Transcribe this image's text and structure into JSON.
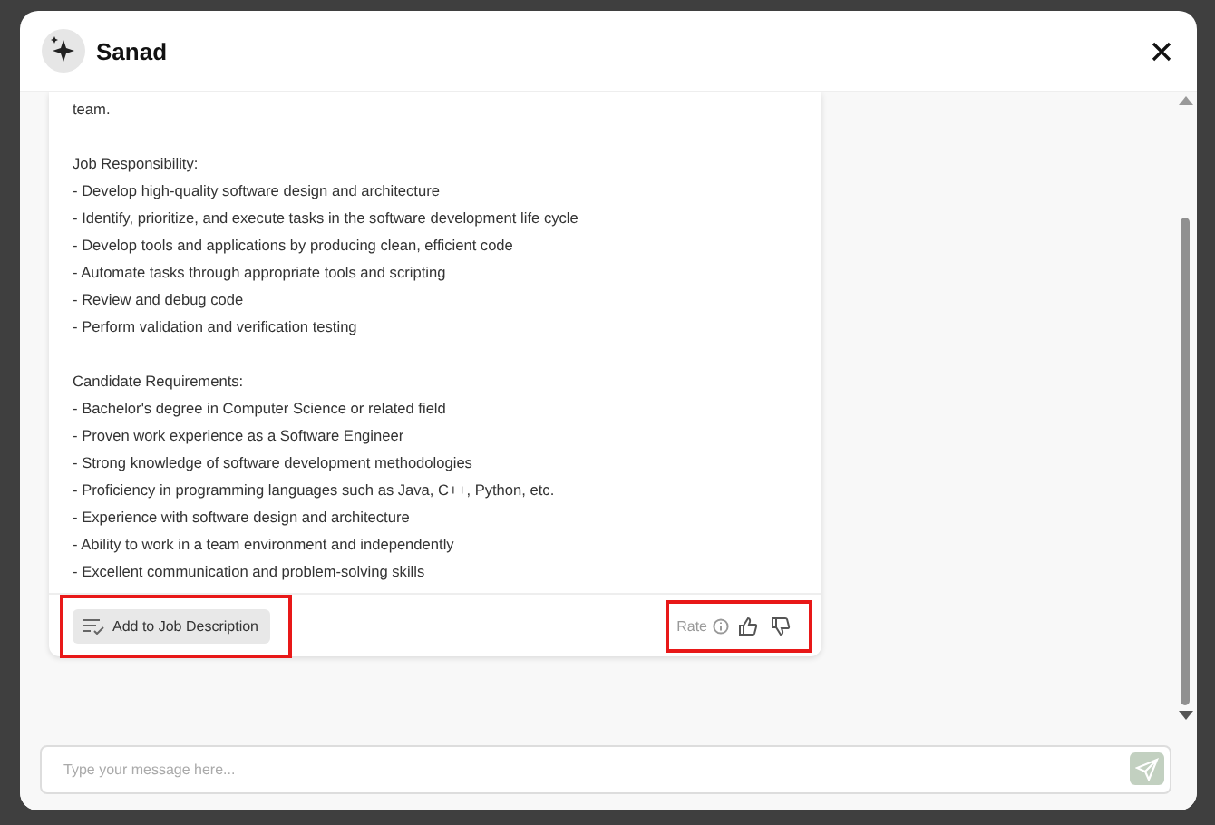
{
  "window": {
    "title": "Sanad"
  },
  "message": {
    "paragraphs": [
      [
        "team."
      ],
      [
        "Job Responsibility:",
        "- Develop high-quality software design and architecture",
        "- Identify, prioritize, and execute tasks in the software development life cycle",
        "- Develop tools and applications by producing clean, efficient code",
        "- Automate tasks through appropriate tools and scripting",
        "- Review and debug code",
        "- Perform validation and verification testing"
      ],
      [
        "Candidate Requirements:",
        "- Bachelor's degree in Computer Science or related field",
        "- Proven work experience as a Software Engineer",
        "- Strong knowledge of software development methodologies",
        "- Proficiency in programming languages such as Java, C++, Python, etc.",
        "- Experience with software design and architecture",
        "- Ability to work in a team environment and independently",
        "- Excellent communication and problem-solving skills"
      ]
    ],
    "add_button": {
      "label": "Add to Job Description",
      "highlighted": true
    },
    "rating": {
      "label": "Rate",
      "highlighted": true
    }
  },
  "composer": {
    "placeholder": "Type your message here..."
  }
}
